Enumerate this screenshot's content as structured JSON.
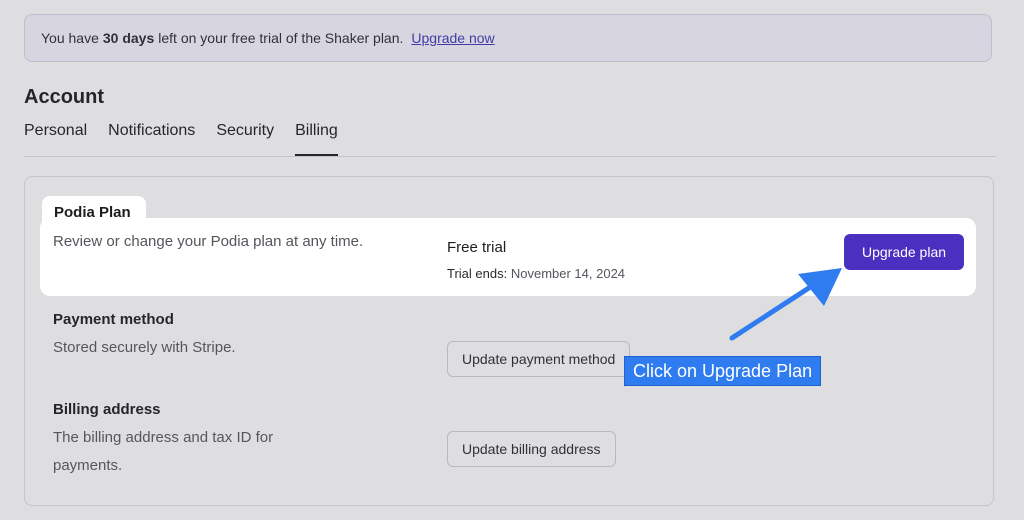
{
  "banner": {
    "prefix": "You have",
    "days": "30 days",
    "suffix": "left on your free trial of the Shaker plan.",
    "link": "Upgrade now"
  },
  "account": {
    "title": "Account",
    "tabs": [
      {
        "label": "Personal",
        "active": false
      },
      {
        "label": "Notifications",
        "active": false
      },
      {
        "label": "Security",
        "active": false
      },
      {
        "label": "Billing",
        "active": true
      }
    ]
  },
  "billing": {
    "plan": {
      "title": "Podia Plan",
      "description": "Review or change your Podia plan at any time.",
      "name": "Free trial",
      "ends_label": "Trial ends:",
      "ends_date": "November 14, 2024",
      "button": "Upgrade plan"
    },
    "payment": {
      "title": "Payment method",
      "description": "Stored securely with Stripe.",
      "button": "Update payment method"
    },
    "address": {
      "title": "Billing address",
      "description": "The billing address and tax ID for payments.",
      "button": "Update billing address"
    }
  },
  "callout": {
    "text": "Click on Upgrade Plan",
    "color": "#2f7bf0"
  },
  "colors": {
    "accent": "#4a2fc0",
    "link": "#3d37b0"
  }
}
